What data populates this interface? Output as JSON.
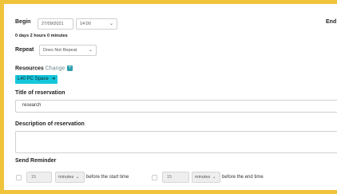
{
  "schedule": {
    "begin_label": "Begin",
    "begin_date": "27/09/2021",
    "begin_time": "14:00",
    "end_label": "End",
    "duration": "0 days 2 hours 0 minutes",
    "repeat_label": "Repeat",
    "repeat_value": "Does Not Repeat"
  },
  "resources": {
    "label": "Resources",
    "change_label": "Change",
    "items": [
      {
        "name": "L40 PC Space"
      }
    ]
  },
  "reservation": {
    "title_label": "Title of reservation",
    "title_value": "research",
    "description_label": "Description of reservation",
    "description_value": ""
  },
  "reminder": {
    "label": "Send Reminder",
    "start": {
      "value": "15",
      "unit": "minutes",
      "text": "before the start time"
    },
    "end": {
      "value": "15",
      "unit": "minutes",
      "text": "before the end time"
    }
  },
  "colors": {
    "accent_border": "#f0c33c",
    "resource_badge": "#16c7dc",
    "change_icon": "#2f9fb0"
  }
}
